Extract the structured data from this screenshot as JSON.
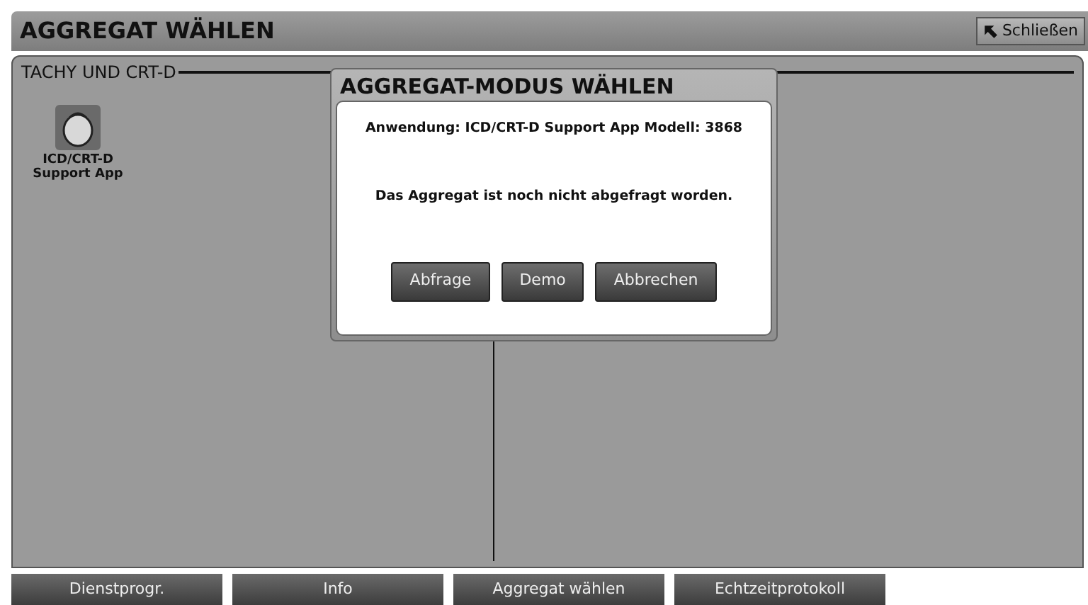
{
  "header": {
    "title": "AGGREGAT WÄHLEN",
    "close_button": "Schließen"
  },
  "section": {
    "title": "TACHY UND CRT-D",
    "apps": [
      {
        "lines": [
          "ICD/CRT-D",
          "Support App"
        ]
      }
    ]
  },
  "dialog": {
    "title": "AGGREGAT-MODUS WÄHLEN",
    "application": "Anwendung: ICD/CRT-D Support App Modell: 3868",
    "message": "Das Aggregat ist noch nicht abgefragt worden.",
    "buttons": [
      "Abfrage",
      "Demo",
      "Abbrechen"
    ]
  },
  "nav_tabs": [
    {
      "label": "Dienstprogr."
    },
    {
      "label": "Info"
    },
    {
      "label": "Aggregat wählen"
    },
    {
      "label": "Echtzeitprotokoll"
    }
  ]
}
